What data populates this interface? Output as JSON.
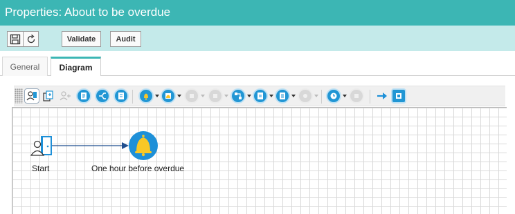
{
  "window": {
    "title": "Properties: About to be overdue"
  },
  "commandbar": {
    "save_icon": "floppy-disk-icon",
    "refresh_icon": "refresh-icon",
    "validate_label": "Validate",
    "audit_label": "Audit"
  },
  "tabs": [
    {
      "label": "General",
      "active": false
    },
    {
      "label": "Diagram",
      "active": true
    }
  ],
  "toolbar": {
    "icons": [
      "add-participant-icon",
      "copy-participant-icon",
      "add-user-disabled-icon",
      "task-icon",
      "parallel-task-icon",
      "task-list-icon",
      "notification-icon",
      "email-notification-icon",
      "disabled-icon",
      "disabled-icon",
      "workflow-icon",
      "document-icon",
      "form-icon",
      "disabled-icon",
      "timer-icon",
      "disabled-icon",
      "arrow-right-icon",
      "end-icon"
    ]
  },
  "diagram": {
    "nodes": [
      {
        "label": "Start",
        "icon": "start-door-icon"
      },
      {
        "label": "One hour before overdue",
        "icon": "bell-icon"
      }
    ],
    "accent_color": "#1e90d8",
    "grid_color": "#d9d9d9"
  },
  "colors": {
    "titlebar": "#3cb6b4",
    "commandbar": "#c4eaea",
    "tab_active_border": "#3cb6b4"
  }
}
